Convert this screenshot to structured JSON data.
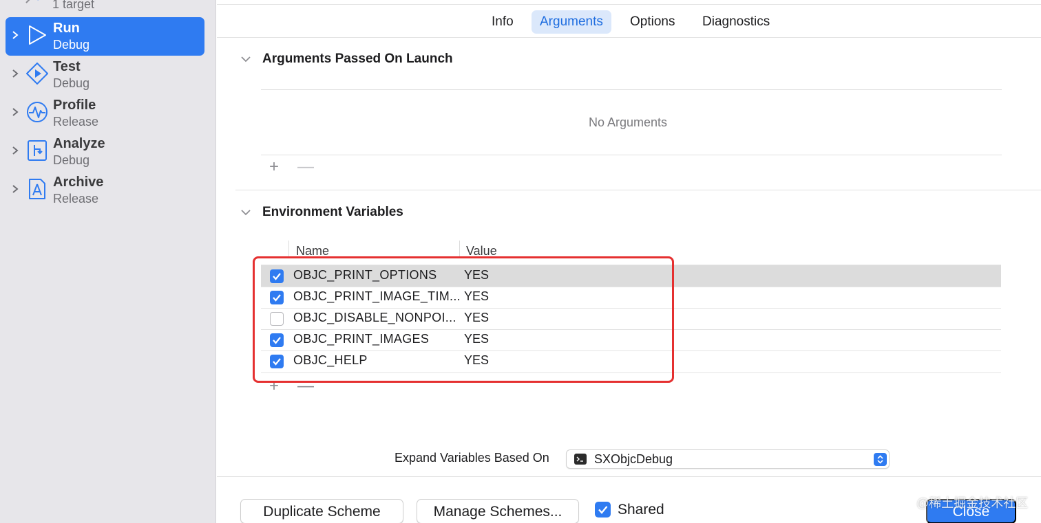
{
  "sidebar": {
    "partial_item": {
      "subtitle": "1 target"
    },
    "items": [
      {
        "title": "Run",
        "subtitle": "Debug",
        "icon": "play-outline-icon",
        "selected": true
      },
      {
        "title": "Test",
        "subtitle": "Debug",
        "icon": "test-diamond-icon",
        "selected": false
      },
      {
        "title": "Profile",
        "subtitle": "Release",
        "icon": "waveform-icon",
        "selected": false
      },
      {
        "title": "Analyze",
        "subtitle": "Debug",
        "icon": "analyze-icon",
        "selected": false
      },
      {
        "title": "Archive",
        "subtitle": "Release",
        "icon": "archive-icon",
        "selected": false
      }
    ]
  },
  "tabs": [
    {
      "label": "Info",
      "active": false
    },
    {
      "label": "Arguments",
      "active": true
    },
    {
      "label": "Options",
      "active": false
    },
    {
      "label": "Diagnostics",
      "active": false
    }
  ],
  "arguments_section": {
    "title": "Arguments Passed On Launch",
    "empty_text": "No Arguments",
    "add": "+",
    "remove": "—"
  },
  "env_section": {
    "title": "Environment Variables",
    "columns": {
      "name": "Name",
      "value": "Value"
    },
    "rows": [
      {
        "name": "OBJC_PRINT_OPTIONS",
        "value": "YES",
        "enabled": true,
        "selected": true
      },
      {
        "name": "OBJC_PRINT_IMAGE_TIM...",
        "value": "YES",
        "enabled": true,
        "selected": false
      },
      {
        "name": "OBJC_DISABLE_NONPOI...",
        "value": "YES",
        "enabled": false,
        "selected": false
      },
      {
        "name": "OBJC_PRINT_IMAGES",
        "value": "YES",
        "enabled": true,
        "selected": false
      },
      {
        "name": "OBJC_HELP",
        "value": "YES",
        "enabled": true,
        "selected": false
      }
    ],
    "add": "+",
    "remove": "—"
  },
  "expand": {
    "label": "Expand Variables Based On",
    "value": "SXObjcDebug",
    "icon": "terminal-icon"
  },
  "footer": {
    "duplicate": "Duplicate Scheme",
    "manage": "Manage Schemes...",
    "shared_label": "Shared",
    "shared_checked": true,
    "close": "Close"
  },
  "watermark": "@稀土掘金技术社区",
  "colors": {
    "accent": "#2f7bf1",
    "highlight_box": "#e53030"
  }
}
